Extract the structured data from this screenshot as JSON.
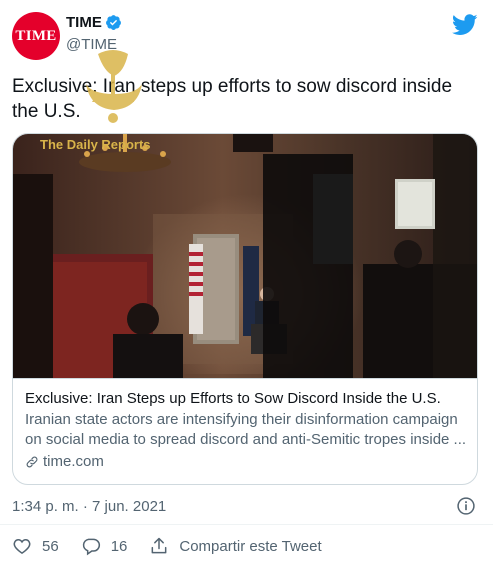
{
  "author": {
    "avatar_text": "TIME",
    "display_name": "TIME",
    "handle": "@TIME"
  },
  "tweet": {
    "text": "Exclusive: Iran steps up efforts to sow discord inside the U.S."
  },
  "watermark": {
    "text": "The Daily Reports"
  },
  "card": {
    "title": "Exclusive: Iran Steps up Efforts to Sow Discord Inside the U.S.",
    "description_line1": "Iranian state actors are intensifying their disinformation campaign",
    "description_line2": "on social media to spread discord and anti-Semitic tropes inside ...",
    "domain": "time.com"
  },
  "meta": {
    "timestamp": "1:34 p. m. · 7 jun. 2021"
  },
  "actions": {
    "likes": "56",
    "replies": "16",
    "share_label": "Compartir este Tweet"
  },
  "colors": {
    "brand_red": "#e4002b",
    "twitter_blue": "#1d9bf0",
    "muted_text": "#536471",
    "border": "#cfd9de"
  }
}
